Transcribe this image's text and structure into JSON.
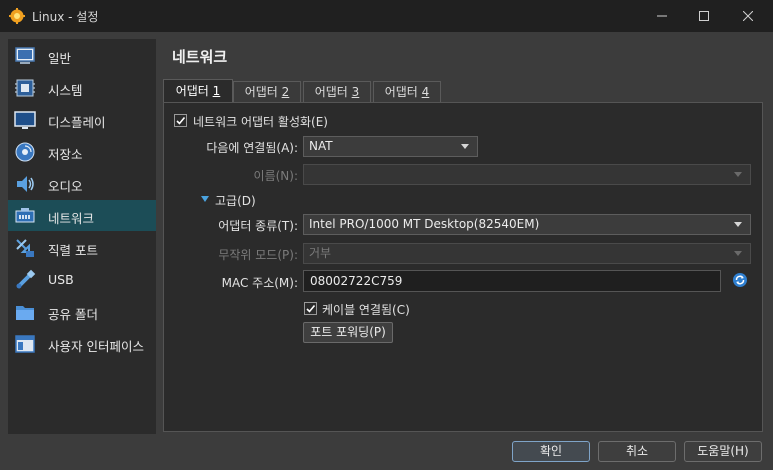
{
  "window": {
    "title": "Linux - 설정",
    "controls": {
      "minimize": "minimize",
      "maximize": "maximize",
      "close": "close"
    }
  },
  "sidebar": {
    "items": [
      {
        "label": "일반",
        "icon": "general-icon"
      },
      {
        "label": "시스템",
        "icon": "system-icon"
      },
      {
        "label": "디스플레이",
        "icon": "display-icon"
      },
      {
        "label": "저장소",
        "icon": "storage-icon"
      },
      {
        "label": "오디오",
        "icon": "audio-icon"
      },
      {
        "label": "네트워크",
        "icon": "network-icon",
        "active": true
      },
      {
        "label": "직렬 포트",
        "icon": "serial-port-icon"
      },
      {
        "label": "USB",
        "icon": "usb-icon"
      },
      {
        "label": "공유 폴더",
        "icon": "shared-folder-icon"
      },
      {
        "label": "사용자 인터페이스",
        "icon": "user-interface-icon"
      }
    ]
  },
  "page": {
    "title": "네트워크"
  },
  "tabs": [
    {
      "label": "어댑터 ",
      "num": "1",
      "active": true
    },
    {
      "label": "어댑터 ",
      "num": "2"
    },
    {
      "label": "어댑터 ",
      "num": "3"
    },
    {
      "label": "어댑터 ",
      "num": "4"
    }
  ],
  "adapter": {
    "enable_label": "네트워크 어댑터 활성화(E)",
    "enable_checked": true,
    "attached_label": "다음에 연결됨(A):",
    "attached_value": "NAT",
    "name_label": "이름(N):",
    "name_value": "",
    "advanced_label": "고급(D)",
    "type_label": "어댑터 종류(T):",
    "type_value": "Intel PRO/1000 MT Desktop(82540EM)",
    "promisc_label": "무작위 모드(P):",
    "promisc_value": "거부",
    "mac_label": "MAC 주소(M):",
    "mac_value": "08002722C759",
    "cable_label": "케이블 연결됨(C)",
    "cable_checked": true,
    "port_forward_label": "포트 포워딩(P)"
  },
  "buttons": {
    "ok": "확인",
    "cancel": "취소",
    "help": "도움말(H)"
  },
  "colors": {
    "accent": "#1c4d57",
    "link_blue": "#4aa3df"
  }
}
